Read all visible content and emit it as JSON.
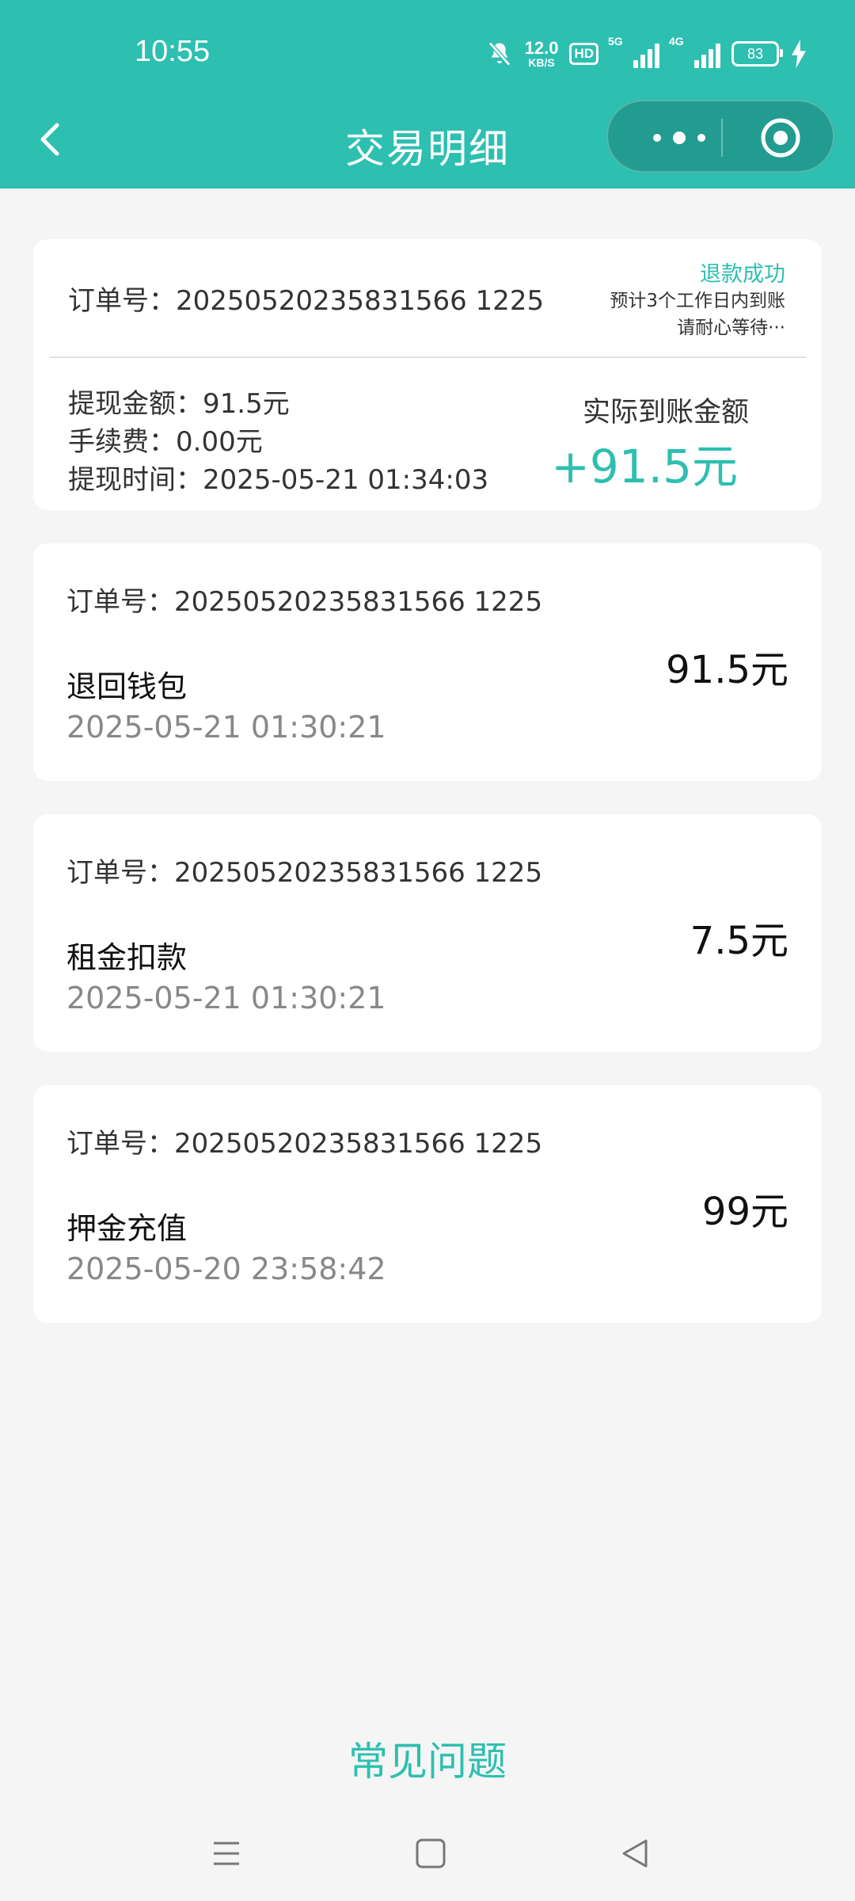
{
  "status_bar": {
    "time": "10:55",
    "net_speed_value": "12.0",
    "net_speed_unit": "KB/S",
    "hd_badge": "HD",
    "signal1_label": "5G",
    "signal2_label": "4G",
    "battery": "83",
    "icons": [
      "mute-bell-icon",
      "signal-5g-icon",
      "signal-4g-icon",
      "battery-icon",
      "charging-icon"
    ]
  },
  "header": {
    "title": "交易明细",
    "back_icon": "chevron-left-icon",
    "more_icon": "more-dots-icon",
    "close_icon": "target-close-icon"
  },
  "withdrawal_card": {
    "order_label": "订单号：",
    "order_no": "20250520235831566 1225",
    "status": "退款成功",
    "note_line1": "预计3个工作日内到账",
    "note_line2": "请耐心等待···",
    "amount_line": "提现金额：91.5元",
    "fee_line": "手续费：0.00元",
    "time_line": "提现时间：2025-05-21 01:34:03",
    "actual_label": "实际到账金额",
    "actual_amount": "+91.5元"
  },
  "transactions": [
    {
      "order_line": "订单号：20250520235831566 1225",
      "name": "退回钱包",
      "time": "2025-05-21 01:30:21",
      "amount": "91.5元"
    },
    {
      "order_line": "订单号：20250520235831566 1225",
      "name": "租金扣款",
      "time": "2025-05-21 01:30:21",
      "amount": "7.5元"
    },
    {
      "order_line": "订单号：20250520235831566 1225",
      "name": "押金充值",
      "time": "2025-05-20 23:58:42",
      "amount": "99元"
    }
  ],
  "faq_link": "常见问题",
  "colors": {
    "brand": "#2dbfb0",
    "capsule": "#229c90",
    "background": "#f5f5f5"
  },
  "nav_icons": [
    "menu-lines-icon",
    "home-square-icon",
    "back-triangle-icon"
  ]
}
